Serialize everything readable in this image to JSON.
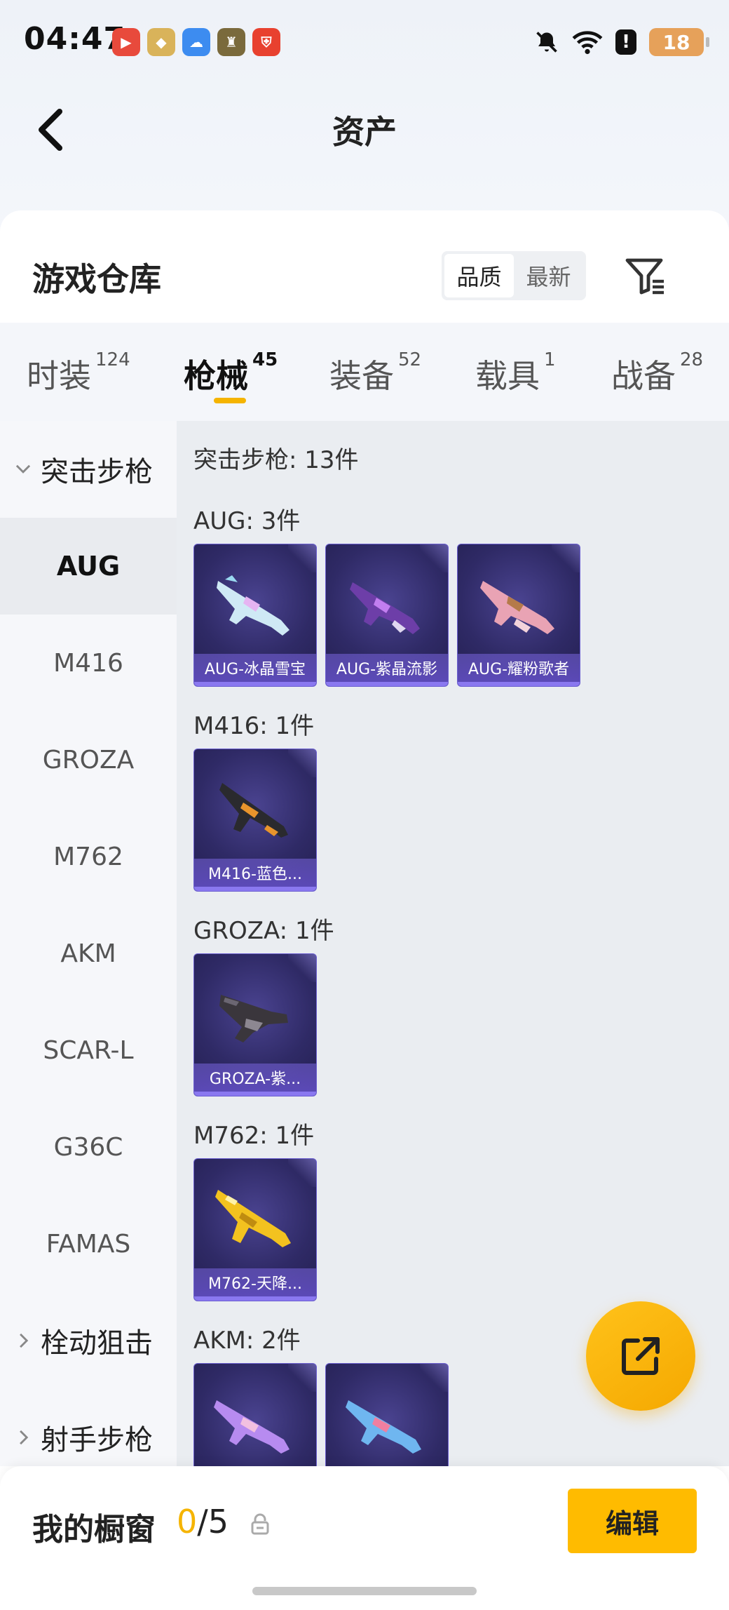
{
  "status_bar": {
    "time": "04:47",
    "battery": "18",
    "alert": "!"
  },
  "header": {
    "title": "资产"
  },
  "warehouse": {
    "title": "游戏仓库",
    "sort_options": [
      "品质",
      "最新"
    ]
  },
  "tabs": [
    {
      "label": "时装",
      "count": "124"
    },
    {
      "label": "枪械",
      "count": "45"
    },
    {
      "label": "装备",
      "count": "52"
    },
    {
      "label": "载具",
      "count": "1"
    },
    {
      "label": "战备",
      "count": "28"
    }
  ],
  "sidebar": {
    "groups": [
      "突击步枪",
      "栓动狙击",
      "射手步枪"
    ],
    "items": [
      "AUG",
      "M416",
      "GROZA",
      "M762",
      "AKM",
      "SCAR-L",
      "G36C",
      "FAMAS"
    ]
  },
  "content": {
    "group_title": "突击步枪: 13件",
    "sections": [
      {
        "title": "AUG: 3件",
        "cards": [
          "AUG-冰晶雪宝",
          "AUG-紫晶流影",
          "AUG-耀粉歌者"
        ]
      },
      {
        "title": "M416: 1件",
        "cards": [
          "M416-蓝色..."
        ]
      },
      {
        "title": "GROZA: 1件",
        "cards": [
          "GROZA-紫..."
        ]
      },
      {
        "title": "M762: 1件",
        "cards": [
          "M762-天降..."
        ]
      },
      {
        "title": "AKM: 2件",
        "cards": [
          "",
          ""
        ]
      }
    ]
  },
  "showcase": {
    "title": "我的橱窗",
    "current": "0",
    "separator": "/",
    "total": "5",
    "edit_label": "编辑"
  }
}
